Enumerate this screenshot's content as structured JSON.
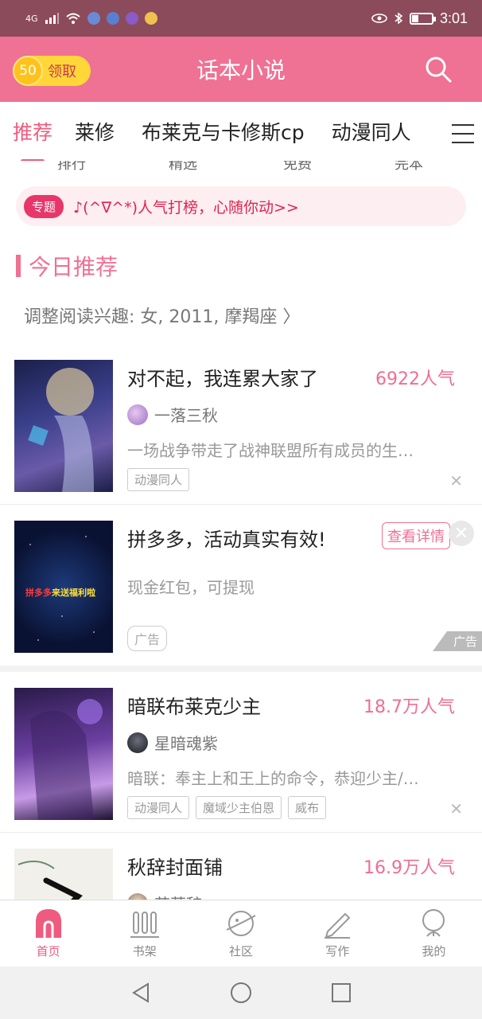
{
  "status_bar": {
    "network": "4G",
    "time": "3:01"
  },
  "header": {
    "coin_amount": "50",
    "coin_label": "领取",
    "title": "话本小说"
  },
  "tabs": [
    {
      "label": "推荐"
    },
    {
      "label": "莱修"
    },
    {
      "label": "布莱克与卡修斯cp"
    },
    {
      "label": "动漫同人"
    }
  ],
  "sub_tabs": [
    "排行",
    "精选",
    "免费",
    "完本"
  ],
  "topic": {
    "tag": "专题",
    "text": "♪(^∇^*)人气打榜，心随你动>>"
  },
  "section": {
    "title": "今日推荐",
    "preference": "调整阅读兴趣: 女, 2011, 摩羯座 〉"
  },
  "books": [
    {
      "title": "对不起，我连累大家了",
      "popularity": "6922人气",
      "author": "一落三秋",
      "desc": "一场战争带走了战神联盟所有成员的生…",
      "tags": [
        "动漫同人"
      ]
    },
    {
      "title": "暗联布莱克少主",
      "popularity": "18.7万人气",
      "author": "星暗魂紫",
      "desc": "暗联：奉主上和王上的命令，恭迎少主/…",
      "tags": [
        "动漫同人",
        "魔域少主伯恩",
        "威布"
      ]
    },
    {
      "title": "秋辞封面铺",
      "popularity": "16.9万人气",
      "author": "苏菀辞丶"
    }
  ],
  "ad": {
    "title": "拼多多，活动真实有效!",
    "button": "查看详情",
    "desc": "现金红包，可提现",
    "tag": "广告",
    "corner": "广告",
    "cover_text_1": "拼多多",
    "cover_text_2": "来送福利啦"
  },
  "bottom_nav": [
    {
      "label": "首页"
    },
    {
      "label": "书架"
    },
    {
      "label": "社区"
    },
    {
      "label": "写作"
    },
    {
      "label": "我的"
    }
  ],
  "colors": {
    "accent": "#ef7194",
    "status": "#8c4b5b"
  }
}
